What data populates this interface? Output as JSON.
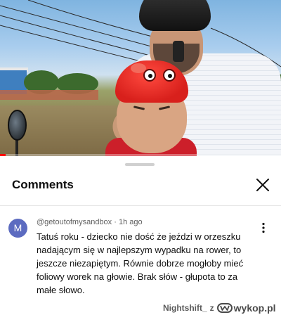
{
  "video": {
    "progress_fraction": 0.02,
    "accent_color": "#ff0000"
  },
  "comments_panel": {
    "title": "Comments",
    "close_icon": "close-icon"
  },
  "comment": {
    "avatar_letter": "M",
    "avatar_color": "#5c6bc0",
    "author": "@getoutofmysandbox",
    "separator": "·",
    "time": "1h ago",
    "text": "Tatuś roku - dziecko nie dość że jeździ w orzeszku nadającym się w najlepszym wypadku na rower, to jeszcze niezapiętym. Równie dobrze mogłoby mieć foliowy worek na głowie. Brak słów - głupota to za małe słowo.",
    "more_icon": "more-vertical-icon"
  },
  "watermark": {
    "user": "Nightshift_",
    "connector": "z",
    "site": "wykop.pl"
  }
}
